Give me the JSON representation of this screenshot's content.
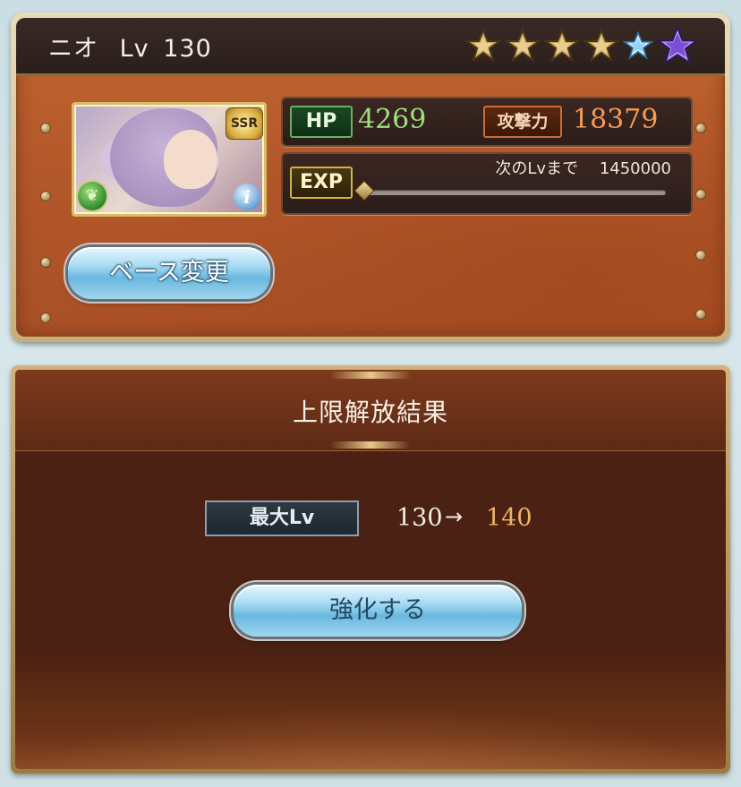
{
  "character": {
    "name": "ニオ",
    "level_prefix": "Lv",
    "level": "130",
    "rarity": "SSR",
    "element_icon": "wind-element-icon",
    "stars": {
      "total": 6,
      "filled": 6
    }
  },
  "stats": {
    "hp_label": "HP",
    "hp_value": "4269",
    "atk_label": "攻撃力",
    "atk_value": "18379",
    "exp_label": "EXP",
    "next_level_label": "次のLvまで",
    "next_level_value": "1450000",
    "exp_progress": 0.0
  },
  "buttons": {
    "change_base": "ベース変更",
    "enhance": "強化する"
  },
  "result_panel": {
    "title": "上限解放結果",
    "max_lv_label": "最大Lv",
    "from": "130",
    "arrow": "→",
    "to": "140"
  },
  "colors": {
    "hp": "#9fe07e",
    "attack": "#f59c55",
    "level_after": "#f0b46a"
  }
}
